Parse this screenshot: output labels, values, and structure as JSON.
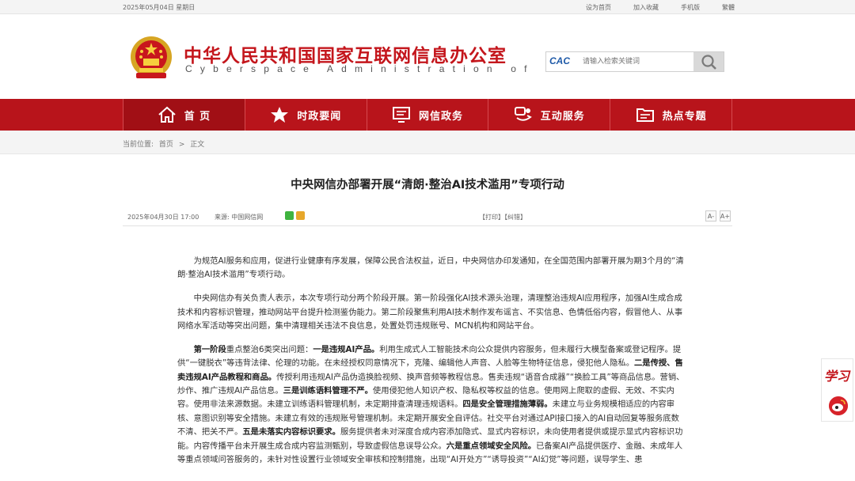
{
  "topbar": {
    "date": "2025年05月04日  星期日",
    "links": [
      "设为首页",
      "加入收藏",
      "手机版",
      "繁體"
    ]
  },
  "header": {
    "title": "中华人民共和国国家互联网信息办公室",
    "subtitle": "Cyberspace Administration of China",
    "search_logo": "CAC",
    "search_placeholder": "请输入检索关键词"
  },
  "nav": [
    {
      "label": "首  页",
      "icon": "home-icon"
    },
    {
      "label": "时政要闻",
      "icon": "star-icon"
    },
    {
      "label": "网信政务",
      "icon": "monitor-icon"
    },
    {
      "label": "互动服务",
      "icon": "handshake-icon"
    },
    {
      "label": "热点专题",
      "icon": "folder-icon"
    }
  ],
  "breadcrumb": {
    "label": "当前位置:",
    "items": [
      "首页",
      ">",
      "正文"
    ]
  },
  "article": {
    "title": "中央网信办部署开展“清朗·整治AI技术滥用”专项行动",
    "date": "2025年04月30日  17:00",
    "source": "来源:   中国网信网",
    "ops": "【打印】【纠错】",
    "font_small": "A-",
    "font_large": "A+",
    "p1": "为规范AI服务和应用，促进行业健康有序发展，保障公民合法权益，近日，中央网信办印发通知，在全国范围内部署开展为期3个月的“清朗·整治AI技术滥用”专项行动。",
    "p2": "中央网信办有关负责人表示，本次专项行动分两个阶段开展。第一阶段强化AI技术源头治理，清理整治违规AI应用程序，加强AI生成合成技术和内容标识管理，推动网站平台提升检测鉴伪能力。第二阶段聚焦利用AI技术制作发布谣言、不实信息、色情低俗内容，假冒他人、从事网络水军活动等突出问题，集中清理相关违法不良信息，处置处罚违规账号、MCN机构和网站平台。",
    "p3_b1": "第一阶段",
    "p3_t1": "重点整治6类突出问题：",
    "p3_b2": "一是违规AI产品。",
    "p3_t2": "利用生成式人工智能技术向公众提供内容服务，但未履行大模型备案或登记程序。提供“一键脱衣”等违背法律、伦理的功能。在未经授权同意情况下，克隆、编辑他人声音、人脸等生物特征信息，侵犯他人隐私。",
    "p3_b3": "二是传授、售卖违规AI产品教程和商品。",
    "p3_t3": "传授利用违规AI产品伪造换脸视频、换声音频等教程信息。售卖违规“语音合成器”“换脸工具”等商品信息。营销、炒作、推广违规AI产品信息。",
    "p3_b4": "三是训练语料管理不严。",
    "p3_t4": "使用侵犯他人知识产权、隐私权等权益的信息。使用网上爬取的虚假、无效、不实内容。使用非法来源数据。未建立训练语料管理机制，未定期排查清理违规语料。",
    "p3_b5": "四是安全管理措施薄弱。",
    "p3_t5": "未建立与业务规模相适应的内容审核、意图识别等安全措施。未建立有效的违规账号管理机制。未定期开展安全自评估。社交平台对通过API接口接入的AI自动回复等服务底数不清、把关不严。",
    "p3_b6": "五是未落实内容标识要求。",
    "p3_t6": "服务提供者未对深度合成内容添加隐式、显式内容标识，未向使用者提供或提示显式内容标识功能。内容传播平台未开展生成合成内容监测甄别，导致虚假信息误导公众。",
    "p3_b7": "六是重点领域安全风险。",
    "p3_t7": "已备案AI产品提供医疗、金融、未成年人等重点领域问答服务的，未针对性设置行业领域安全审核和控制措施，出现“AI开处方”“诱导投资”“AI幻觉”等问题，误导学生、患"
  },
  "float": {
    "xuexi": "学习"
  }
}
